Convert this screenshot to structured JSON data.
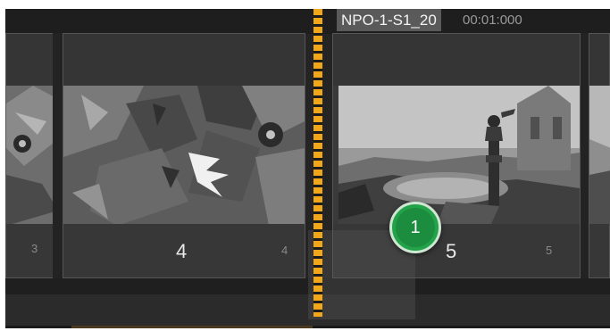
{
  "clip": {
    "name": "NPO-1-S1_20",
    "timecode": "00:01:000"
  },
  "panels": [
    {
      "big_number": "",
      "small_number": "3"
    },
    {
      "big_number": "4",
      "small_number": "4"
    },
    {
      "big_number": "5",
      "small_number": "5"
    }
  ],
  "badge": {
    "count": "1"
  },
  "colors": {
    "playhead": "#f2a71b",
    "badge": "#22a34a",
    "panel_bg": "#3a3a3a",
    "timeline_bg": "#242424"
  }
}
